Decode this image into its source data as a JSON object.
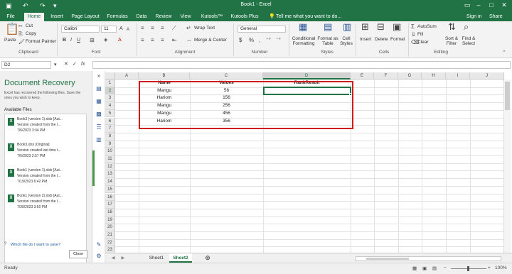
{
  "titlebar": {
    "title": "Book1 - Excel"
  },
  "menu": {
    "tabs": [
      "File",
      "Home",
      "Insert",
      "Page Layout",
      "Formulas",
      "Data",
      "Review",
      "View",
      "Kutools™",
      "Kutools Plus"
    ],
    "tell_me": "Tell me what you want to do...",
    "signin": "Sign in",
    "share": "Share"
  },
  "ribbon": {
    "clipboard": {
      "paste": "Paste",
      "cut": "Cut",
      "copy": "Copy",
      "format_painter": "Format Painter",
      "label": "Clipboard"
    },
    "font": {
      "name": "Calibri",
      "size": "11",
      "label": "Font"
    },
    "alignment": {
      "wrap": "Wrap Text",
      "merge": "Merge & Center",
      "label": "Alignment"
    },
    "number": {
      "format": "General",
      "label": "Number"
    },
    "styles": {
      "conditional": "Conditional Formatting",
      "format_as_table": "Format as Table",
      "cell_styles": "Cell Styles",
      "label": "Styles"
    },
    "cells": {
      "insert": "Insert",
      "delete": "Delete",
      "format": "Format",
      "label": "Cells"
    },
    "editing": {
      "autosum": "AutoSum",
      "fill": "Fill",
      "clear": "Clear",
      "sort": "Sort & Filter",
      "find": "Find & Select",
      "label": "Editing"
    }
  },
  "formula": {
    "namebox": "D2"
  },
  "recovery": {
    "title": "Document Recovery",
    "desc": "Excel has recovered the following files. Save the ones you wish to keep.",
    "available": "Available Files",
    "files": [
      {
        "name": "Book3 (version 1).xlsb [Aut...",
        "line2": "Version created from the l...",
        "date": "7/6/2023 3:34 PM"
      },
      {
        "name": "Book3.xlsx [Original]",
        "line2": "Version created last time t...",
        "date": "7/6/2023 2:57 PM"
      },
      {
        "name": "Book1 (version 1).xlsb [Aut...",
        "line2": "Version created from the l...",
        "date": "7/19/2023 6:42 PM"
      },
      {
        "name": "Book1 (version 2).xlsb [Aut...",
        "line2": "Version created from the l...",
        "date": "7/30/2023 3:50 PM"
      }
    ],
    "help": "Which file do I want to save?",
    "close": "Close"
  },
  "grid": {
    "columns": [
      "A",
      "B",
      "C",
      "D",
      "E",
      "F",
      "G",
      "H",
      "I",
      "J"
    ],
    "rows": [
      "1",
      "2",
      "3",
      "4",
      "5",
      "6",
      "7",
      "8",
      "9",
      "10",
      "11",
      "12",
      "13",
      "14",
      "15",
      "16",
      "17",
      "18",
      "19",
      "20",
      "21",
      "22",
      "23"
    ],
    "headers": [
      "Name",
      "Values",
      "RankResult"
    ],
    "data": [
      {
        "name": "Mangu",
        "value": "56"
      },
      {
        "name": "Hariom",
        "value": "156"
      },
      {
        "name": "Mangu",
        "value": "256"
      },
      {
        "name": "Mangu",
        "value": "456"
      },
      {
        "name": "Hariom",
        "value": "356"
      }
    ]
  },
  "sheets": {
    "tabs": [
      "Sheet1",
      "Sheet2"
    ],
    "active": "Sheet2"
  },
  "status": {
    "ready": "Ready",
    "zoom": "100%"
  }
}
